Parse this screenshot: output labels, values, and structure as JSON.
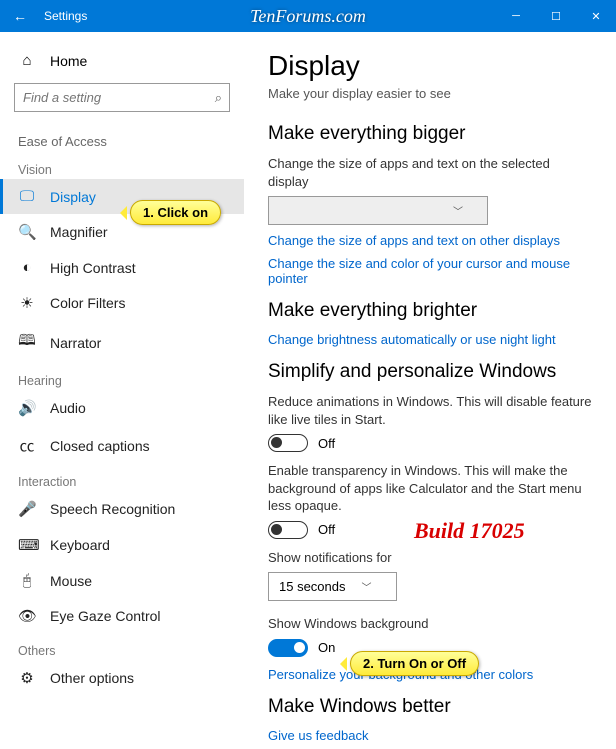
{
  "window": {
    "title": "Settings"
  },
  "watermark": "TenForums.com",
  "sidebar": {
    "home": "Home",
    "search_placeholder": "Find a setting",
    "section": "Ease of Access",
    "groups": {
      "vision": {
        "label": "Vision",
        "items": [
          "Display",
          "Magnifier",
          "High Contrast",
          "Color Filters",
          "Narrator"
        ]
      },
      "hearing": {
        "label": "Hearing",
        "items": [
          "Audio",
          "Closed captions"
        ]
      },
      "interaction": {
        "label": "Interaction",
        "items": [
          "Speech Recognition",
          "Keyboard",
          "Mouse",
          "Eye Gaze Control"
        ]
      },
      "others": {
        "label": "Others",
        "items": [
          "Other options"
        ]
      }
    }
  },
  "page": {
    "title": "Display",
    "subtitle": "Make your display easier to see",
    "sec1": {
      "h": "Make everything bigger",
      "desc": "Change the size of apps and text on the selected display",
      "dropdown": "",
      "link1": "Change the size of apps and text on other displays",
      "link2": "Change the size and color of your cursor and mouse pointer"
    },
    "sec2": {
      "h": "Make everything brighter",
      "link": "Change brightness automatically or use night light"
    },
    "sec3": {
      "h": "Simplify and personalize Windows",
      "t1desc": "Reduce animations in Windows.  This will disable feature like live tiles in Start.",
      "t1state": "Off",
      "t2desc": "Enable transparency in Windows.  This will make the background of apps like Calculator and the Start menu less opaque.",
      "t2state": "Off",
      "notif_label": "Show notifications for",
      "notif_value": "15 seconds",
      "bg_label": "Show Windows background",
      "bg_state": "On",
      "bg_link": "Personalize your background and other colors"
    },
    "sec4": {
      "h": "Make Windows better",
      "link": "Give us feedback"
    }
  },
  "annotations": {
    "callout1": "1. Click on",
    "callout2": "2. Turn On or Off",
    "build": "Build 17025"
  }
}
